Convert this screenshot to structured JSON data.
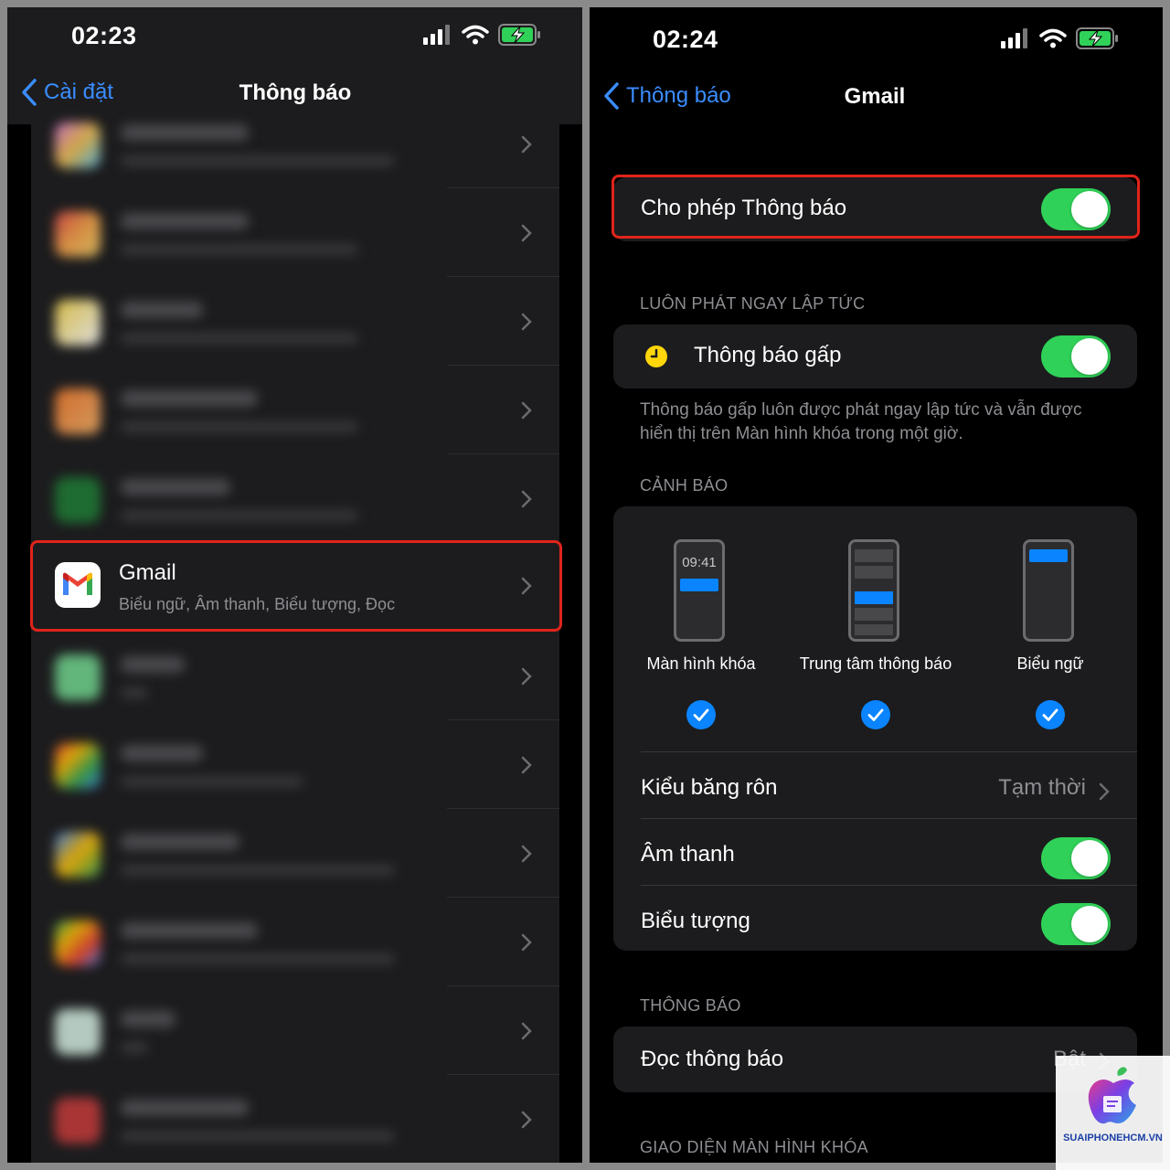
{
  "left_screen": {
    "time": "02:23",
    "back_label": "Cài đặt",
    "title": "Thông báo",
    "gmail_item": {
      "title": "Gmail",
      "subtitle": "Biểu ngữ, Âm thanh, Biểu tượng, Đọc"
    }
  },
  "right_screen": {
    "time": "02:24",
    "back_label": "Thông báo",
    "title": "Gmail",
    "allow_notifications": {
      "label": "Cho phép Thông báo",
      "on": true
    },
    "section_always": "LUÔN PHÁT NGAY LẬP TỨC",
    "time_sensitive": {
      "label": "Thông báo gấp",
      "on": true
    },
    "time_sensitive_desc_line1": "Thông báo gấp luôn được phát ngay lập tức và vẫn được",
    "time_sensitive_desc_line2": "hiển thị trên Màn hình khóa trong một giờ.",
    "section_alerts": "CẢNH BÁO",
    "alerts": {
      "lock_screen_time": "09:41",
      "lock_screen": "Màn hình khóa",
      "notification_center": "Trung tâm thông báo",
      "banners": "Biểu ngữ"
    },
    "banner_style": {
      "label": "Kiểu băng rôn",
      "value": "Tạm thời"
    },
    "sounds": {
      "label": "Âm thanh",
      "on": true
    },
    "badges": {
      "label": "Biểu tượng",
      "on": true
    },
    "section_announce": "THÔNG BÁO",
    "announce": {
      "label": "Đọc thông báo",
      "value": "Bật"
    },
    "section_lock_appearance": "GIAO DIỆN MÀN HÌNH KHÓA"
  },
  "watermark": "SUAIPHONEHCM.VN",
  "colors": {
    "accent_blue": "#3a8dff",
    "toggle_green": "#30d158",
    "highlight_red": "#e0241b",
    "check_blue": "#0a84ff"
  }
}
